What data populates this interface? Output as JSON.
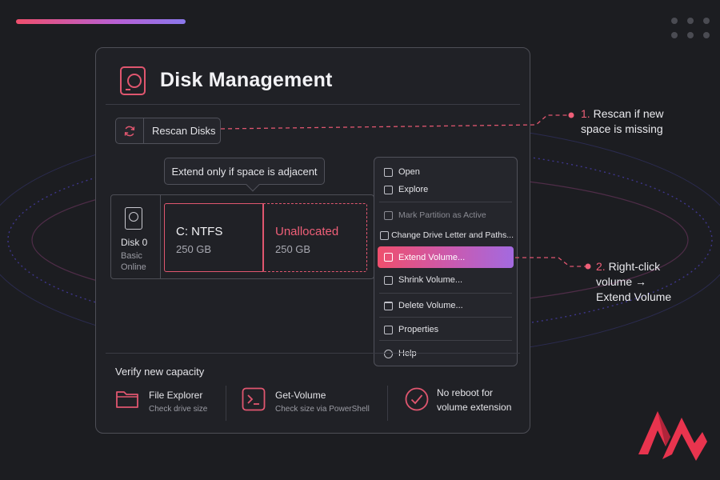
{
  "window": {
    "title": "Disk Management",
    "rescan_label": "Rescan Disks",
    "tooltip": "Extend only if space is adjacent"
  },
  "disk": {
    "name": "Disk 0",
    "type": "Basic",
    "status": "Online",
    "partitions": [
      {
        "name": "C: NTFS",
        "size": "250 GB"
      },
      {
        "name": "Unallocated",
        "size": "250 GB"
      }
    ]
  },
  "context_menu": {
    "items": [
      {
        "label": "Open",
        "icon": "folder-icon"
      },
      {
        "label": "Explore",
        "icon": "explore-icon"
      },
      {
        "label": "Mark Partition as Active",
        "icon": "folder-icon",
        "disabled": true
      },
      {
        "label": "Change Drive Letter and Paths...",
        "icon": "folder-icon"
      },
      {
        "label": "Extend Volume...",
        "icon": "extend-icon",
        "highlighted": true
      },
      {
        "label": "Shrink Volume...",
        "icon": "shrink-icon"
      },
      {
        "label": "Delete Volume...",
        "icon": "trash-icon"
      },
      {
        "label": "Properties",
        "icon": "properties-icon"
      },
      {
        "label": "Help",
        "icon": "help-icon"
      }
    ]
  },
  "verify": {
    "title": "Verify new capacity",
    "tools": [
      {
        "title": "File Explorer",
        "subtitle": "Check drive size",
        "icon": "folder-icon"
      },
      {
        "title": "Get-Volume",
        "subtitle": "Check size via PowerShell",
        "icon": "terminal-icon"
      },
      {
        "title": "No reboot for",
        "subtitle": "volume extension",
        "icon": "check-circle-icon"
      }
    ]
  },
  "callouts": {
    "step1": {
      "num": "1.",
      "line1": "Rescan if new",
      "line2": "space is missing"
    },
    "step2": {
      "num": "2.",
      "line1": "Right-click",
      "line2": "volume →",
      "line3": "Extend Volume"
    }
  },
  "colors": {
    "accent": "#e0566f",
    "accent_purple": "#a36ae0",
    "background": "#1c1d21",
    "panel": "#202126"
  }
}
